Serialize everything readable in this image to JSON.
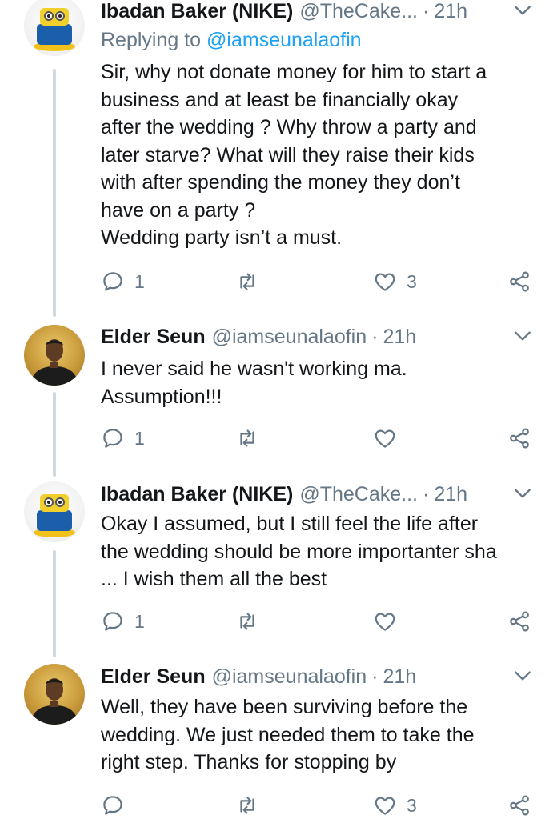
{
  "tweets": [
    {
      "name": "Ibadan Baker (NIKE)",
      "handle": "@TheCake...",
      "sep": "·",
      "time": "21h",
      "replying_label": "Replying to",
      "replying_to": "@iamseunalaofin",
      "lines": [
        "Sir, why not donate money for him to start a",
        "business and at least be financially okay",
        "after the wedding ? Why throw a party and",
        "later starve? What will they raise their kids",
        "with after spending the money they don’t",
        "have on a party ?",
        "Wedding party isn’t a must."
      ],
      "reply_count": "1",
      "retweet_count": "",
      "like_count": "3",
      "avatar_icon": "cake-avatar"
    },
    {
      "name": "Elder Seun",
      "handle": "@iamseunalaofin",
      "sep": "·",
      "time": "21h",
      "lines": [
        "I never said he wasn't working ma.",
        "Assumption!!!"
      ],
      "reply_count": "1",
      "retweet_count": "",
      "like_count": "",
      "avatar_icon": "person-avatar"
    },
    {
      "name": "Ibadan Baker (NIKE)",
      "handle": "@TheCake...",
      "sep": "·",
      "time": "21h",
      "lines": [
        "Okay I assumed, but I still feel the life after",
        "the wedding should be more importanter sha",
        "... I wish them all the best"
      ],
      "reply_count": "1",
      "retweet_count": "",
      "like_count": "",
      "avatar_icon": "cake-avatar"
    },
    {
      "name": "Elder Seun",
      "handle": "@iamseunalaofin",
      "sep": "·",
      "time": "21h",
      "lines": [
        "Well, they have been surviving before the",
        "wedding. We just needed them to take the",
        "right step. Thanks for stopping by"
      ],
      "reply_count": "",
      "retweet_count": "",
      "like_count": "3",
      "avatar_icon": "person-avatar"
    }
  ],
  "colors": {
    "text": "#14171a",
    "muted": "#657786",
    "link": "#1da1f2",
    "thread_line": "#cfd9de"
  }
}
